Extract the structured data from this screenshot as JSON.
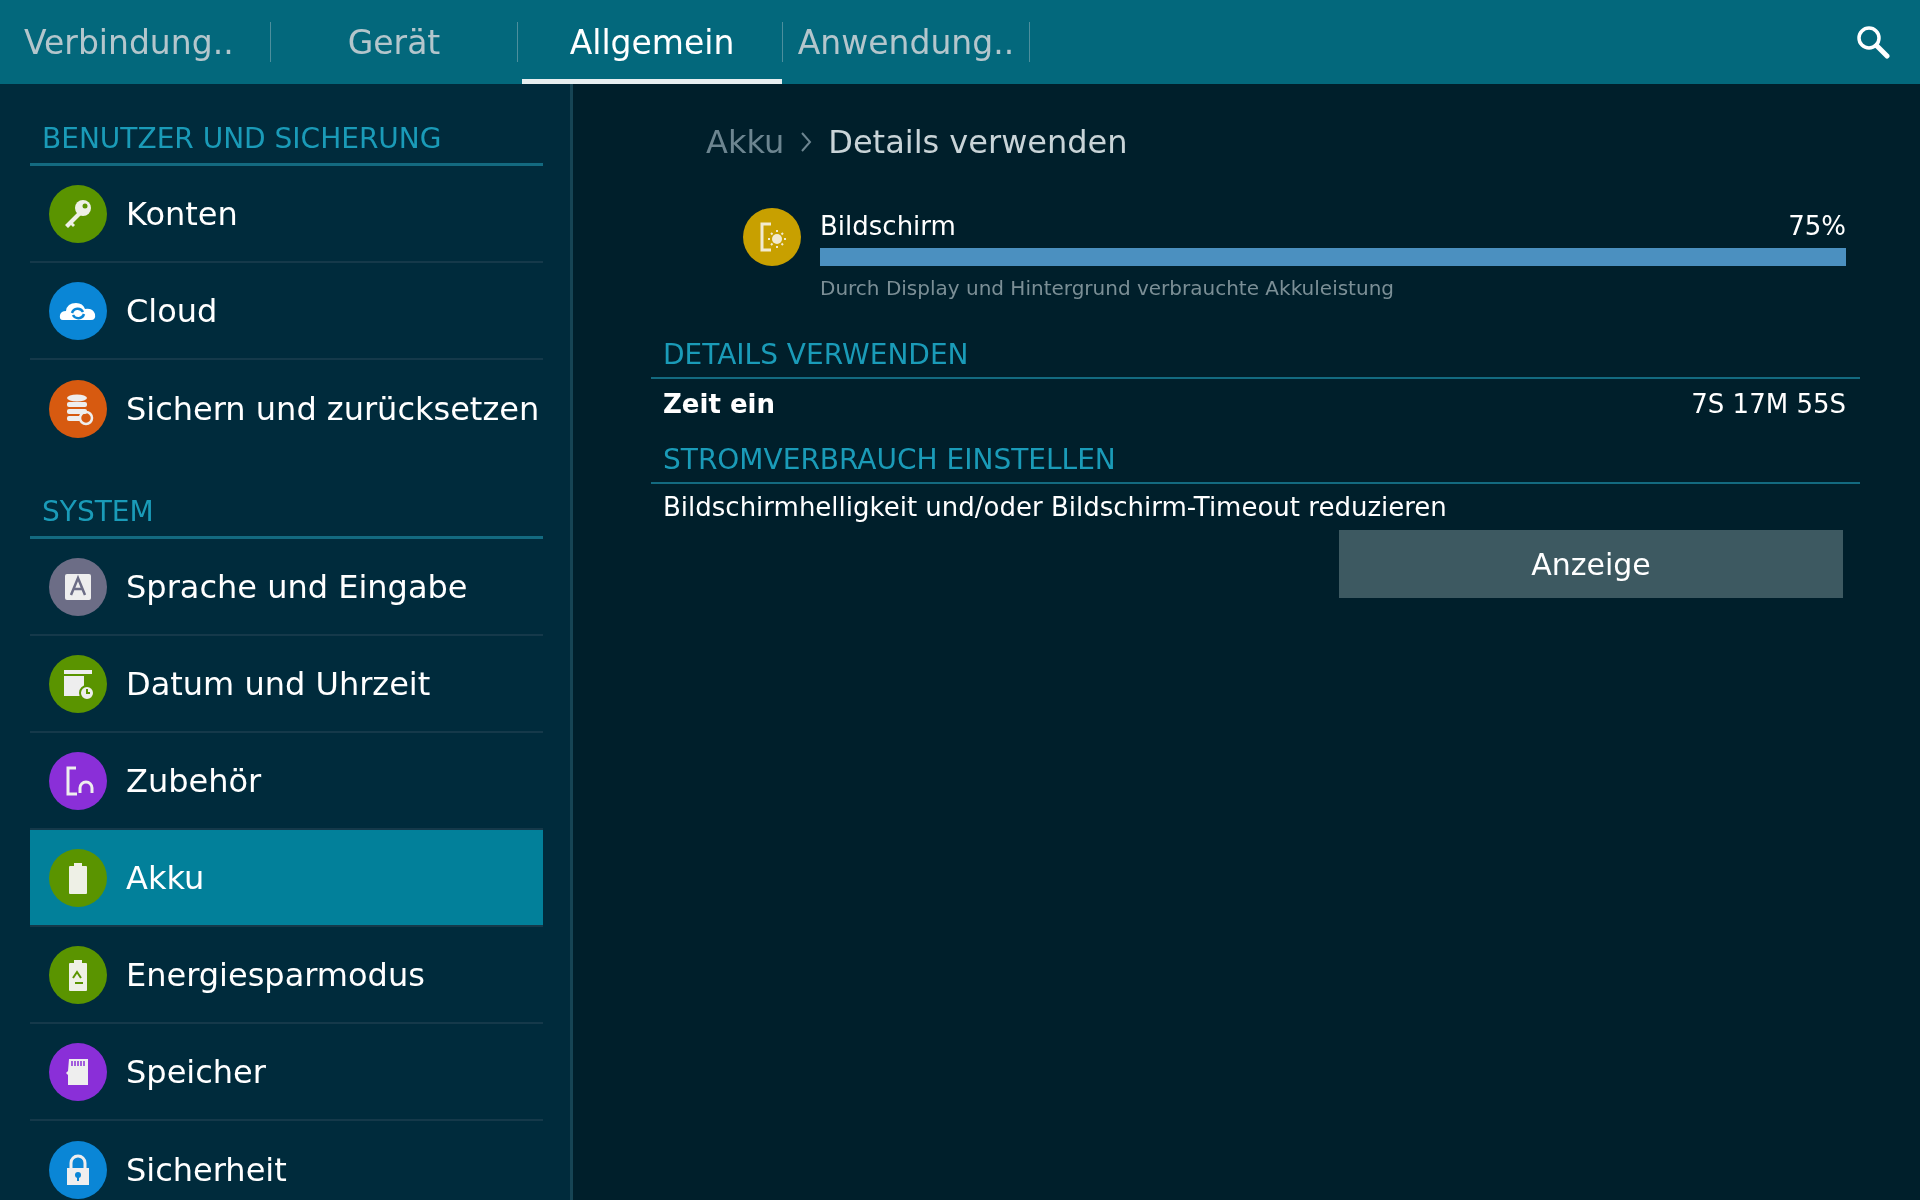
{
  "tabs": [
    {
      "label": "Verbindung..",
      "selected": false
    },
    {
      "label": "Gerät",
      "selected": false
    },
    {
      "label": "Allgemein",
      "selected": true
    },
    {
      "label": "Anwendung..",
      "selected": false
    }
  ],
  "sidebar": {
    "sections": [
      {
        "title": "BENUTZER UND SICHERUNG",
        "items": [
          {
            "label": "Konten",
            "kind": "key",
            "color": "#5a9400",
            "selected": false
          },
          {
            "label": "Cloud",
            "kind": "cloud",
            "color": "#0a86d6",
            "selected": false
          },
          {
            "label": "Sichern und zurücksetzen",
            "kind": "backup",
            "color": "#d75a10",
            "selected": false
          }
        ]
      },
      {
        "title": "SYSTEM",
        "items": [
          {
            "label": "Sprache und Eingabe",
            "kind": "language",
            "color": "#6c6d86",
            "selected": false
          },
          {
            "label": "Datum und Uhrzeit",
            "kind": "calendar",
            "color": "#5a9400",
            "selected": false
          },
          {
            "label": "Zubehör",
            "kind": "accessory",
            "color": "#8a2fd8",
            "selected": false
          },
          {
            "label": "Akku",
            "kind": "battery",
            "color": "#5a9400",
            "selected": true
          },
          {
            "label": "Energiesparmodus",
            "kind": "powersave",
            "color": "#5a9400",
            "selected": false
          },
          {
            "label": "Speicher",
            "kind": "storage",
            "color": "#8a2fd8",
            "selected": false
          },
          {
            "label": "Sicherheit",
            "kind": "lock",
            "color": "#0a86d6",
            "selected": false
          }
        ]
      }
    ]
  },
  "breadcrumb": {
    "parent": "Akku",
    "current": "Details verwenden"
  },
  "usage": {
    "label": "Bildschirm",
    "percent": "75%",
    "description": "Durch Display und Hintergrund verbrauchte Akkuleistung"
  },
  "details": {
    "title": "DETAILS VERWENDEN",
    "rows": [
      {
        "label": "Zeit ein",
        "value": "7S 17M 55S"
      }
    ]
  },
  "power": {
    "title": "STROMVERBRAUCH EINSTELLEN",
    "text": "Bildschirmhelligkeit und/oder Bildschirm-Timeout reduzieren",
    "button": "Anzeige"
  }
}
